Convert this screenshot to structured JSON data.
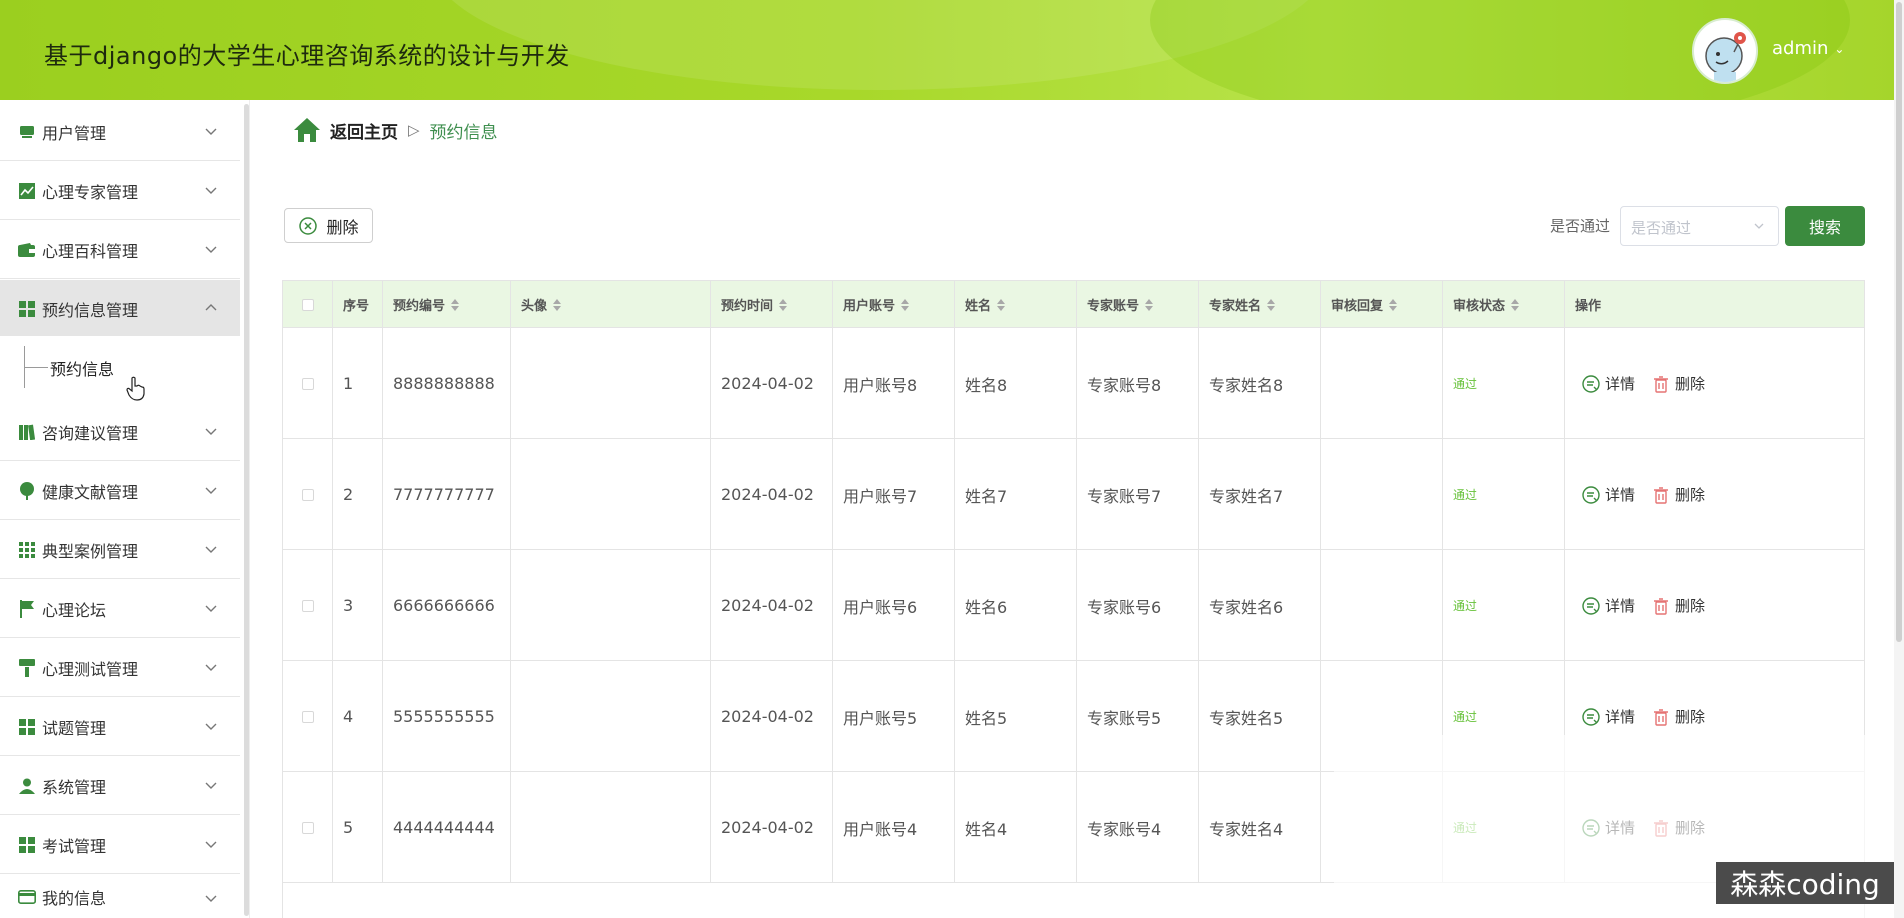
{
  "app": {
    "title": "基于django的大学生心理咨询系统的设计与开发",
    "user": "admin"
  },
  "sidebar": {
    "items": [
      {
        "label": "用户管理",
        "icon": "user-card-icon"
      },
      {
        "label": "心理专家管理",
        "icon": "trend-chart-icon"
      },
      {
        "label": "心理百科管理",
        "icon": "wallet-icon"
      },
      {
        "label": "预约信息管理",
        "icon": "grid-icon"
      },
      {
        "label": "咨询建议管理",
        "icon": "books-icon"
      },
      {
        "label": "健康文献管理",
        "icon": "leaf-icon"
      },
      {
        "label": "典型案例管理",
        "icon": "apps-grid-icon"
      },
      {
        "label": "心理论坛",
        "icon": "flag-icon"
      },
      {
        "label": "心理测试管理",
        "icon": "paint-roller-icon"
      },
      {
        "label": "试题管理",
        "icon": "grid-icon"
      },
      {
        "label": "系统管理",
        "icon": "person-icon"
      },
      {
        "label": "考试管理",
        "icon": "grid-icon"
      },
      {
        "label": "我的信息",
        "icon": "id-card-icon"
      }
    ],
    "submenu": {
      "label": "预约信息"
    }
  },
  "breadcrumb": {
    "home": "返回主页",
    "separator": "▷",
    "current": "预约信息"
  },
  "toolbar": {
    "delete_label": "删除",
    "filter_label": "是否通过",
    "filter_placeholder": "是否通过",
    "search_label": "搜索"
  },
  "table": {
    "headers": [
      "序号",
      "预约编号",
      "头像",
      "预约时间",
      "用户账号",
      "姓名",
      "专家账号",
      "专家姓名",
      "审核回复",
      "审核状态",
      "操作"
    ],
    "rows": [
      {
        "index": "1",
        "booking_no": "8888888888",
        "avatar": "",
        "time": "2024-04-02",
        "user_account": "用户账号8",
        "name": "姓名8",
        "expert_account": "专家账号8",
        "expert_name": "专家姓名8",
        "reply": "",
        "status": "通过"
      },
      {
        "index": "2",
        "booking_no": "7777777777",
        "avatar": "",
        "time": "2024-04-02",
        "user_account": "用户账号7",
        "name": "姓名7",
        "expert_account": "专家账号7",
        "expert_name": "专家姓名7",
        "reply": "",
        "status": "通过"
      },
      {
        "index": "3",
        "booking_no": "6666666666",
        "avatar": "",
        "time": "2024-04-02",
        "user_account": "用户账号6",
        "name": "姓名6",
        "expert_account": "专家账号6",
        "expert_name": "专家姓名6",
        "reply": "",
        "status": "通过"
      },
      {
        "index": "4",
        "booking_no": "5555555555",
        "avatar": "",
        "time": "2024-04-02",
        "user_account": "用户账号5",
        "name": "姓名5",
        "expert_account": "专家账号5",
        "expert_name": "专家姓名5",
        "reply": "",
        "status": "通过"
      },
      {
        "index": "5",
        "booking_no": "4444444444",
        "avatar": "",
        "time": "2024-04-02",
        "user_account": "用户账号4",
        "name": "姓名4",
        "expert_account": "专家账号4",
        "expert_name": "专家姓名4",
        "reply": "",
        "status": "通过"
      }
    ],
    "actions": {
      "detail": "详情",
      "delete": "删除"
    }
  },
  "watermark": "森森coding",
  "colors": {
    "accent": "#3b8b3e",
    "header": "#a8d82a",
    "status": "#67c23a"
  }
}
